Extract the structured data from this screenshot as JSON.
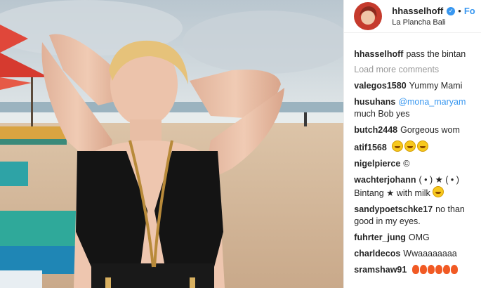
{
  "post_header": {
    "username": "hhasselhoff",
    "verified_icon": "verified-badge-icon",
    "separator": "•",
    "follow_label": "Fo",
    "location": "La Plancha Bali"
  },
  "caption": {
    "username": "hhasselhoff",
    "text": "pass the bintan"
  },
  "load_more_label": "Load more comments",
  "comments": [
    {
      "username": "valegos1580",
      "text": "Yummy Mami"
    },
    {
      "username": "husuhans",
      "mention": "@mona_maryam",
      "text2": "much Bob yes"
    },
    {
      "username": "butch2448",
      "text": "Gorgeous wom"
    },
    {
      "username": "atif1568",
      "emoji_count": 3,
      "emoji_icon": "grinning-face-icon"
    },
    {
      "username": "nigelpierce",
      "text": "©"
    },
    {
      "username": "wachterjohann",
      "text": "( • ) ★ ( • )",
      "text2": "Bintang ★ with milk"
    },
    {
      "username": "sandypoetschke17",
      "text": "no than",
      "text2": "good in my eyes."
    },
    {
      "username": "fuhrter_jung",
      "text": "OMG"
    },
    {
      "username": "charldecos",
      "text": "Wwaaaaaaaa"
    },
    {
      "username": "sramshaw91",
      "emoji_icon": "fire-icon",
      "emoji_count": 6
    }
  ],
  "colors": {
    "link": "#3897f0",
    "text": "#262626",
    "muted": "#999999",
    "border": "#efefef"
  }
}
